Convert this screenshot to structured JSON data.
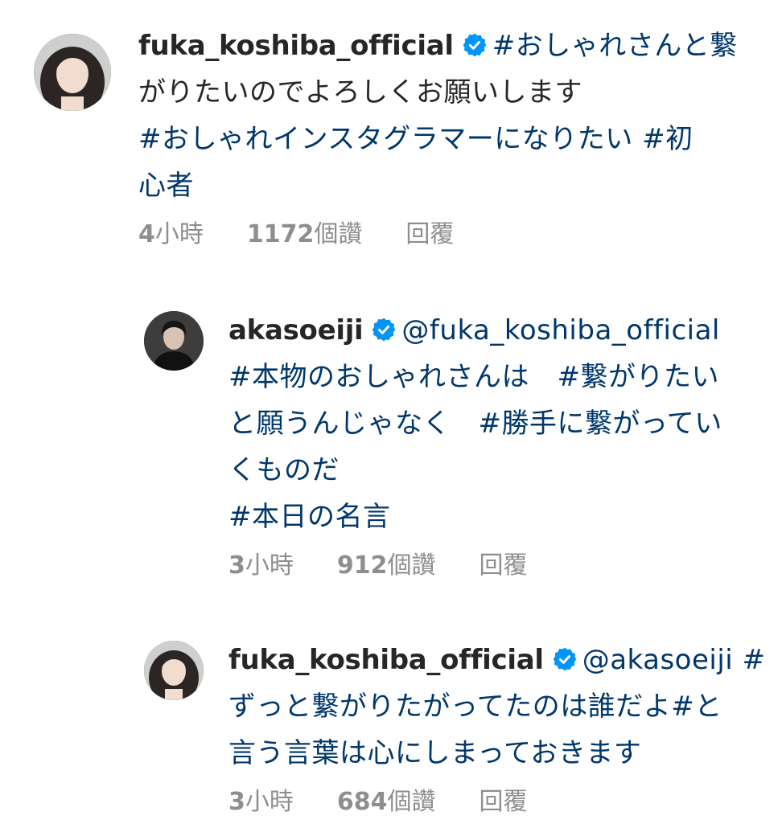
{
  "comments": [
    {
      "username": "fuka_koshiba_official",
      "verified": true,
      "text_lines": [
        "#おしゃれさんと繋",
        "がりたいのでよろしくお願いします",
        "#おしゃれインスタグラマーになりたい #初",
        "心者"
      ],
      "time_num": "4",
      "time_unit": "小時",
      "likes_num": "1172",
      "likes_unit": "個讚",
      "reply_label": "回覆"
    },
    {
      "username": "akasoeiji",
      "verified": true,
      "text_lines": [
        "@fuka_koshiba_official",
        "#本物のおしゃれさんは　#繋がりたい",
        "と願うんじゃなく　#勝手に繋がってい",
        "くものだ",
        "#本日の名言"
      ],
      "time_num": "3",
      "time_unit": "小時",
      "likes_num": "912",
      "likes_unit": "個讚",
      "reply_label": "回覆"
    },
    {
      "username": "fuka_koshiba_official",
      "verified": true,
      "text_lines": [
        "@akasoeiji #",
        "ずっと繋がりたがってたのは誰だよ#と",
        "言う言葉は心にしまっておきます"
      ],
      "time_num": "3",
      "time_unit": "小時",
      "likes_num": "684",
      "likes_unit": "個讚",
      "reply_label": "回覆"
    }
  ],
  "colors": {
    "text": "#262626",
    "link": "#00376b",
    "meta": "#8e8e8e",
    "verified": "#0095f6"
  },
  "icons": {
    "verified": "verified-badge-icon"
  }
}
